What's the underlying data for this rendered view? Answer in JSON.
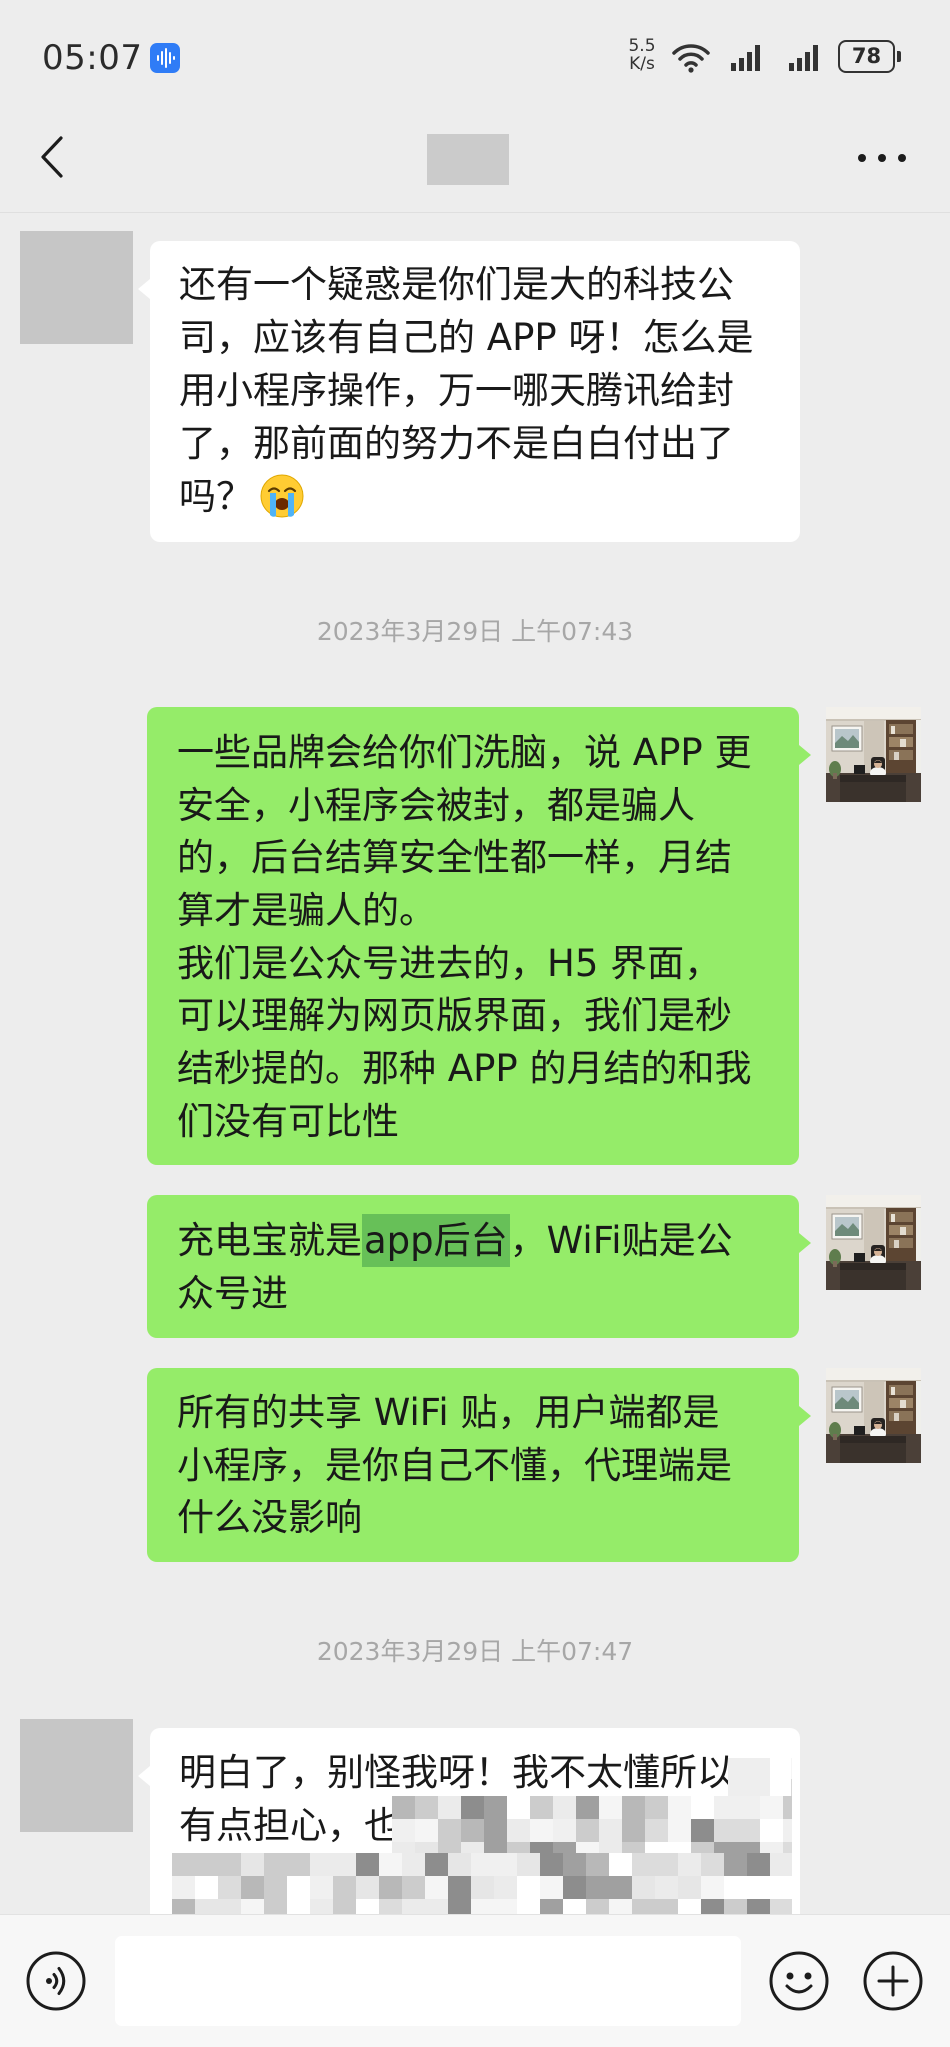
{
  "status_bar": {
    "time": "05:07",
    "indicator_icon": "voice-wave-icon",
    "network_speed": {
      "value": "5.5",
      "unit": "K/s"
    },
    "wifi_icon": "wifi-icon",
    "signal_icons": [
      "signal-bars-icon",
      "signal-bars-icon"
    ],
    "battery_icon": "battery-icon",
    "battery_level": "78"
  },
  "nav_bar": {
    "back_icon": "chevron-left-icon",
    "more_icon": "more-dots-icon"
  },
  "chat": {
    "message_1": {
      "lines": [
        "还有一个疑惑是你们是大的科技公",
        "司，应该有自己的 APP 呀！怎么是",
        "用小程序操作，万一哪天腾讯给封",
        "了，那前面的努力不是白白付出了",
        "吗？"
      ],
      "emoji": "loudly-crying-face-emoji"
    },
    "timestamp_1": "2023年3月29日 上午07:43",
    "message_2": {
      "lines": [
        "一些品牌会给你们洗脑，说 APP 更",
        "安全，小程序会被封，都是骗人",
        "的，后台结算安全性都一样，月结",
        "算才是骗人的。",
        "我们是公众号进去的，H5 界面，",
        "可以理解为网页版界面，我们是秒",
        "结秒提的。那种 APP 的月结的和我",
        "们没有可比性"
      ]
    },
    "message_3": {
      "line_1": {
        "before": "充电宝就是",
        "highlighted": "app后台",
        "after": "，WiFi贴是公"
      },
      "line_2": "众号进"
    },
    "message_4": {
      "lines": [
        "所有的共享 WiFi 贴，用户端都是",
        "小程序，是你自己不懂，代理端是",
        "什么没影响"
      ]
    },
    "timestamp_2": "2023年3月29日 上午07:47",
    "message_5": {
      "lines": [
        "明白了，别怪我呀！我不太懂所以",
        "有点担心，也"
      ]
    }
  },
  "avatars": {
    "other": "avatar-placeholder",
    "me": "avatar-photo"
  },
  "input_bar": {
    "voice_icon": "voice-input-icon",
    "message_input_value": "",
    "emoji_icon": "emoji-smile-icon",
    "plus_icon": "plus-circle-icon"
  },
  "colors": {
    "background": "#ededed",
    "received_bubble": "#ffffff",
    "sent_bubble": "#95ec69",
    "highlight": "#67c058",
    "timestamp_text": "#a7a7a7",
    "input_bar": "#f7f7f7",
    "indicator_blue": "#2f7cf6",
    "text": "#191919",
    "avatar_placeholder": "#c6c6c6"
  }
}
